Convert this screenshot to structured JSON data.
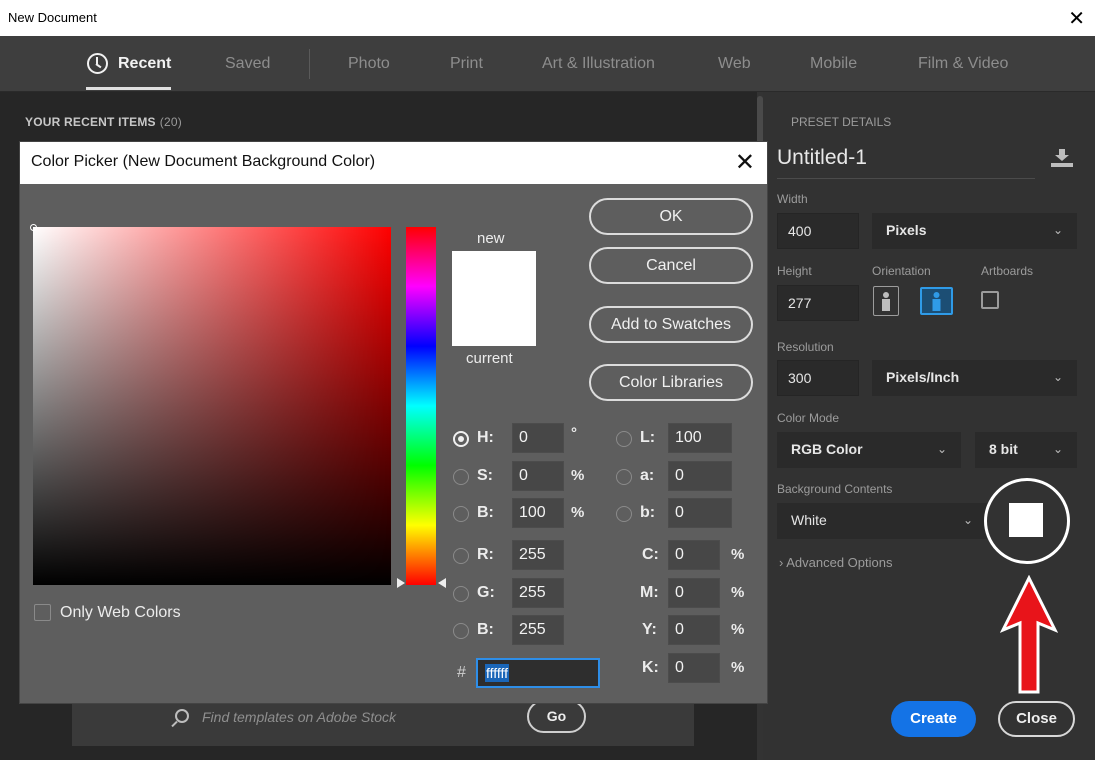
{
  "window": {
    "title": "New Document",
    "close_glyph": "✕"
  },
  "tabs": [
    {
      "label": "Recent",
      "active": true
    },
    {
      "label": "Saved"
    },
    {
      "label": "Photo"
    },
    {
      "label": "Print"
    },
    {
      "label": "Art & Illustration"
    },
    {
      "label": "Web"
    },
    {
      "label": "Mobile"
    },
    {
      "label": "Film & Video"
    }
  ],
  "recent": {
    "title": "YOUR RECENT ITEMS",
    "count": "(20)"
  },
  "stock": {
    "placeholder": "Find templates on Adobe Stock",
    "go_label": "Go"
  },
  "preset": {
    "section_title": "PRESET DETAILS",
    "name": "Untitled-1",
    "width_label": "Width",
    "width_value": "400",
    "width_unit": "Pixels",
    "height_label": "Height",
    "height_value": "277",
    "orientation_label": "Orientation",
    "artboards_label": "Artboards",
    "resolution_label": "Resolution",
    "resolution_value": "300",
    "resolution_unit": "Pixels/Inch",
    "color_mode_label": "Color Mode",
    "color_mode": "RGB Color",
    "bit_depth": "8 bit",
    "bg_label": "Background Contents",
    "bg_value": "White",
    "advanced_label": "Advanced Options",
    "create_label": "Create",
    "close_label": "Close",
    "bg_color": "#ffffff",
    "accent_color": "#1473e6"
  },
  "picker": {
    "title": "Color Picker (New Document Background Color)",
    "close_glyph": "✕",
    "new_label": "new",
    "current_label": "current",
    "buttons": {
      "ok": "OK",
      "cancel": "Cancel",
      "add_swatches": "Add to Swatches",
      "color_libraries": "Color Libraries"
    },
    "hsb": {
      "h_label": "H:",
      "h_value": "0",
      "h_unit": "°",
      "s_label": "S:",
      "s_value": "0",
      "s_unit": "%",
      "b_label": "B:",
      "b_value": "100",
      "b_unit": "%"
    },
    "rgb": {
      "r_label": "R:",
      "r_value": "255",
      "g_label": "G:",
      "g_value": "255",
      "b_label": "B:",
      "b_value": "255"
    },
    "lab": {
      "l_label": "L:",
      "l_value": "100",
      "a_label": "a:",
      "a_value": "0",
      "b_label": "b:",
      "b_value": "0"
    },
    "cmyk": {
      "c_label": "C:",
      "c_value": "0",
      "m_label": "M:",
      "m_value": "0",
      "y_label": "Y:",
      "y_value": "0",
      "k_label": "K:",
      "k_value": "0",
      "unit": "%"
    },
    "hex_label": "#",
    "hex_value": "ffffff",
    "web_colors_label": "Only Web Colors",
    "selected_color": "#ffffff",
    "hue_color": "#ff0000"
  }
}
